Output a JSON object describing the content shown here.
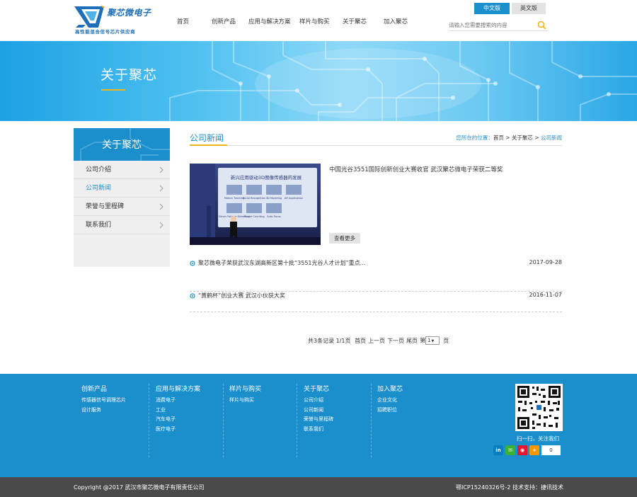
{
  "header": {
    "logo_text": "聚芯微电子",
    "logo_subtitle": "高性能混合信号芯片供应商",
    "nav": [
      {
        "label": "首页"
      },
      {
        "label": "创新产品"
      },
      {
        "label": "应用与解决方案"
      },
      {
        "label": "样片与购买"
      },
      {
        "label": "关于聚芯"
      },
      {
        "label": "加入聚芯"
      }
    ],
    "lang_cn": "中文版",
    "lang_en": "英文版",
    "search_placeholder": "请输入您需要搜索的内容"
  },
  "banner": {
    "title": "关于聚芯"
  },
  "sidebar": {
    "title": "关于聚芯",
    "items": [
      {
        "label": "公司介绍",
        "active": false
      },
      {
        "label": "公司新闻",
        "active": true
      },
      {
        "label": "荣誉与里程碑",
        "active": false
      },
      {
        "label": "联系我们",
        "active": false
      }
    ]
  },
  "main": {
    "title": "公司新闻",
    "breadcrumb": {
      "lead": "您所在的位置：",
      "home": "首页",
      "sep1": " > ",
      "section": "关于聚芯",
      "sep2": " > ",
      "current": "公司新闻"
    },
    "featured": {
      "title": "中国光谷3551国际创新创业大赛收官 武汉聚芯微电子荣获二等奖",
      "more_label": "查看更多",
      "image_heading": "新兴应用驱动3D图像传感器的发展",
      "image_cells": [
        "Motion Tracking",
        "Facial Recognition",
        "3D Modeling",
        "AR Application",
        "Driver Fatigue Detection",
        "People Counting",
        "Auto Focus"
      ]
    },
    "news": [
      {
        "title": "聚芯微电子荣获武汉东湖高新区第十批“3551光谷人才计划”重点...",
        "date": "2017-09-28"
      },
      {
        "title": "“黄鹤杯”创业大赛 武汉小伙获大奖",
        "date": "2016-11-07"
      }
    ],
    "pager": {
      "summary": "共3条记录 1/1页",
      "first": "首页",
      "prev": "上一页",
      "next": "下一页",
      "last": "尾页",
      "goto_prefix": "第",
      "page_value": "1",
      "goto_suffix": "页"
    }
  },
  "footer": {
    "columns": [
      {
        "title": "创新产品",
        "links": [
          "传感器信号调理芯片",
          "设计服务"
        ]
      },
      {
        "title": "应用与解决方案",
        "links": [
          "消费电子",
          "工业",
          "汽车电子",
          "医疗电子"
        ]
      },
      {
        "title": "样片与购买",
        "links": [
          "样片与购买"
        ]
      },
      {
        "title": "关于聚芯",
        "links": [
          "公司介绍",
          "公司新闻",
          "荣誉与里程碑",
          "联系我们"
        ]
      },
      {
        "title": "加入聚芯",
        "links": [
          "企业文化",
          "招聘职位"
        ]
      }
    ],
    "qr_caption": "扫一扫，关注我们",
    "social": [
      {
        "icon": "linkedin-icon",
        "glyph": "in",
        "color": "#0a7bbf"
      },
      {
        "icon": "wechat-icon",
        "glyph": "✉",
        "color": "#3cb034"
      },
      {
        "icon": "weibo-icon",
        "glyph": "◉",
        "color": "#e6162d"
      },
      {
        "icon": "plus-share-icon",
        "glyph": "+",
        "color": "#f39800"
      }
    ],
    "like_count": "0",
    "copyright": "Copyright @2017    武汉市聚芯微电子有限责任公司",
    "icp": "鄂ICP15240326号-2 技术支持：捷讯技术"
  },
  "colors": {
    "primary": "#1b8fcc",
    "accent": "#f1b51c",
    "footer_bottom": "#4a4a4a"
  }
}
